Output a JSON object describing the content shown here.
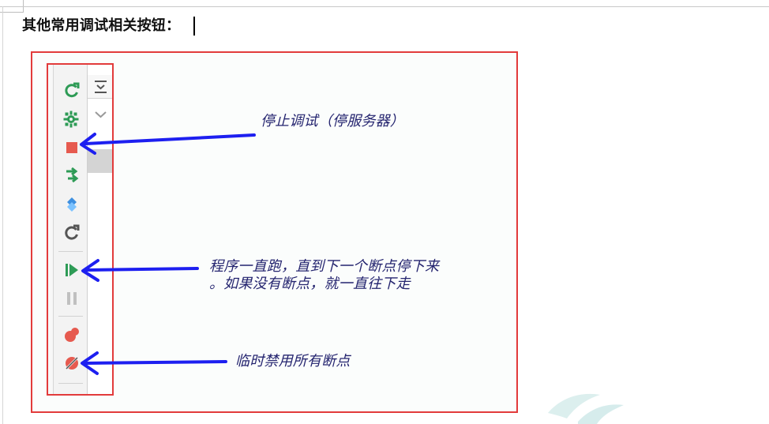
{
  "heading": {
    "text": "其他常用调试相关按钮："
  },
  "toolbar": {
    "buttons": [
      {
        "name": "rerun-icon",
        "kind": "rerun"
      },
      {
        "name": "settings-debug-icon",
        "kind": "gear"
      },
      {
        "name": "stop-icon",
        "kind": "stop"
      },
      {
        "name": "step-over-icon",
        "kind": "step"
      },
      {
        "name": "breakpoint-view-icon",
        "kind": "diamond"
      },
      {
        "name": "refresh-icon",
        "kind": "refresh"
      },
      {
        "name": "resume-icon",
        "kind": "resume"
      },
      {
        "name": "pause-icon",
        "kind": "pause"
      },
      {
        "name": "view-breakpoints-icon",
        "kind": "breakpoints"
      },
      {
        "name": "mute-breakpoints-icon",
        "kind": "mute"
      }
    ]
  },
  "annotations": {
    "stop": "停止调试（停服务器）",
    "resume_line1": "程序一直跑，直到下一个断点停下来",
    "resume_line2": "。如果没有断点，就一直往下走",
    "mute": "临时禁用所有断点"
  },
  "colors": {
    "frame_red": "#e23b3b",
    "arrow_blue": "#1d1ff0",
    "annotation_text": "#24246f",
    "icon_green": "#2e9b56",
    "icon_red": "#e65a4f",
    "icon_blue": "#3d8fe0",
    "icon_gray": "#7f7f7f"
  }
}
